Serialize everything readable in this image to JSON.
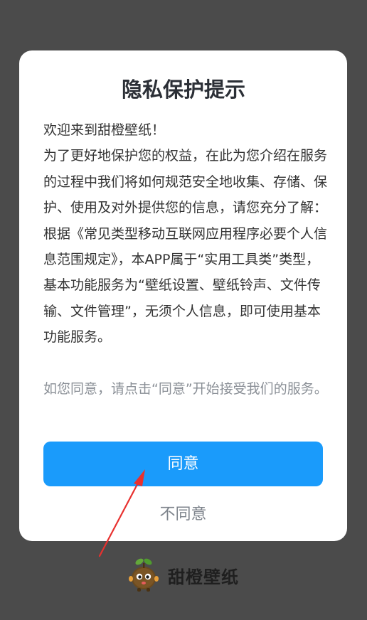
{
  "dialog": {
    "title": "隐私保护提示",
    "paragraphs": [
      "欢迎来到甜橙壁纸！",
      "为了更好地保护您的权益，在此为您介绍在服务的过程中我们将如何规范安全地收集、存储、保护、使用及对外提供您的信息，请您充分了解：",
      "根据《常见类型移动互联网应用程序必要个人信息范围规定》，本APP属于“实用工具类”类型，基本功能服务为“壁纸设置、壁纸铃声、文件传输、文件管理”，无须个人信息，即可使用基本功能服务。"
    ],
    "consent_note": "如您同意，请点击“同意”开始接受我们的服务。",
    "agree_label": "同意",
    "disagree_label": "不同意"
  },
  "brand": {
    "name": "甜橙壁纸",
    "logo_icon": "orange-mascot-icon"
  },
  "annotation": {
    "icon": "red-arrow-icon",
    "color": "#e8312f"
  },
  "colors": {
    "backdrop": "#4b4b4b",
    "accent": "#1a9bfb",
    "title": "#2b2f36",
    "muted": "#8a8f96"
  }
}
